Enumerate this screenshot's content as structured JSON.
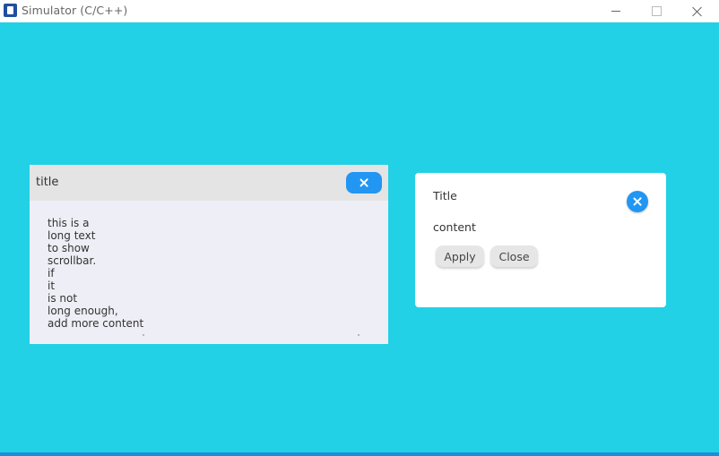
{
  "window": {
    "title": "Simulator (C/C++)"
  },
  "left_window": {
    "title": "title",
    "close_icon": "close-icon",
    "body_lines": [
      "this is a",
      "long text",
      "to show",
      "scrollbar.",
      "if",
      "it",
      "is not",
      "long enough,",
      "add more content"
    ]
  },
  "msgbox": {
    "title": "Title",
    "content": "content",
    "buttons": [
      "Apply",
      "Close"
    ],
    "close_icon": "close-icon"
  },
  "colors": {
    "background": "#22d1e6",
    "accent": "#2196f3",
    "window_header": "#e4e4e4",
    "window_body": "#eeeef6"
  }
}
